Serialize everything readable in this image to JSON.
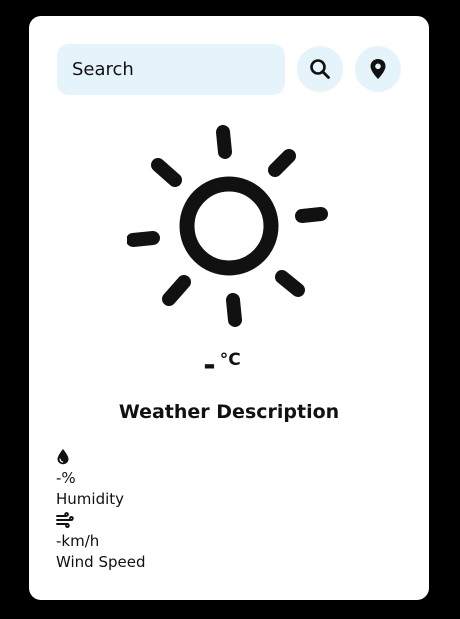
{
  "search": {
    "placeholder": "Search"
  },
  "icons": {
    "search_button": "search-icon",
    "location_button": "map-pin-icon",
    "weather": "sun-icon",
    "humidity": "water-drop-icon",
    "wind": "wind-icon"
  },
  "weather": {
    "temperature": "-",
    "unit": "°C",
    "description": "Weather Description"
  },
  "humidity": {
    "value": "-%",
    "label": "Humidity"
  },
  "wind": {
    "value": "-km/h",
    "label": "Wind Speed"
  },
  "colors": {
    "background": "#000000",
    "card": "#ffffff",
    "accent": "#e5f4fb",
    "text": "#111111"
  }
}
